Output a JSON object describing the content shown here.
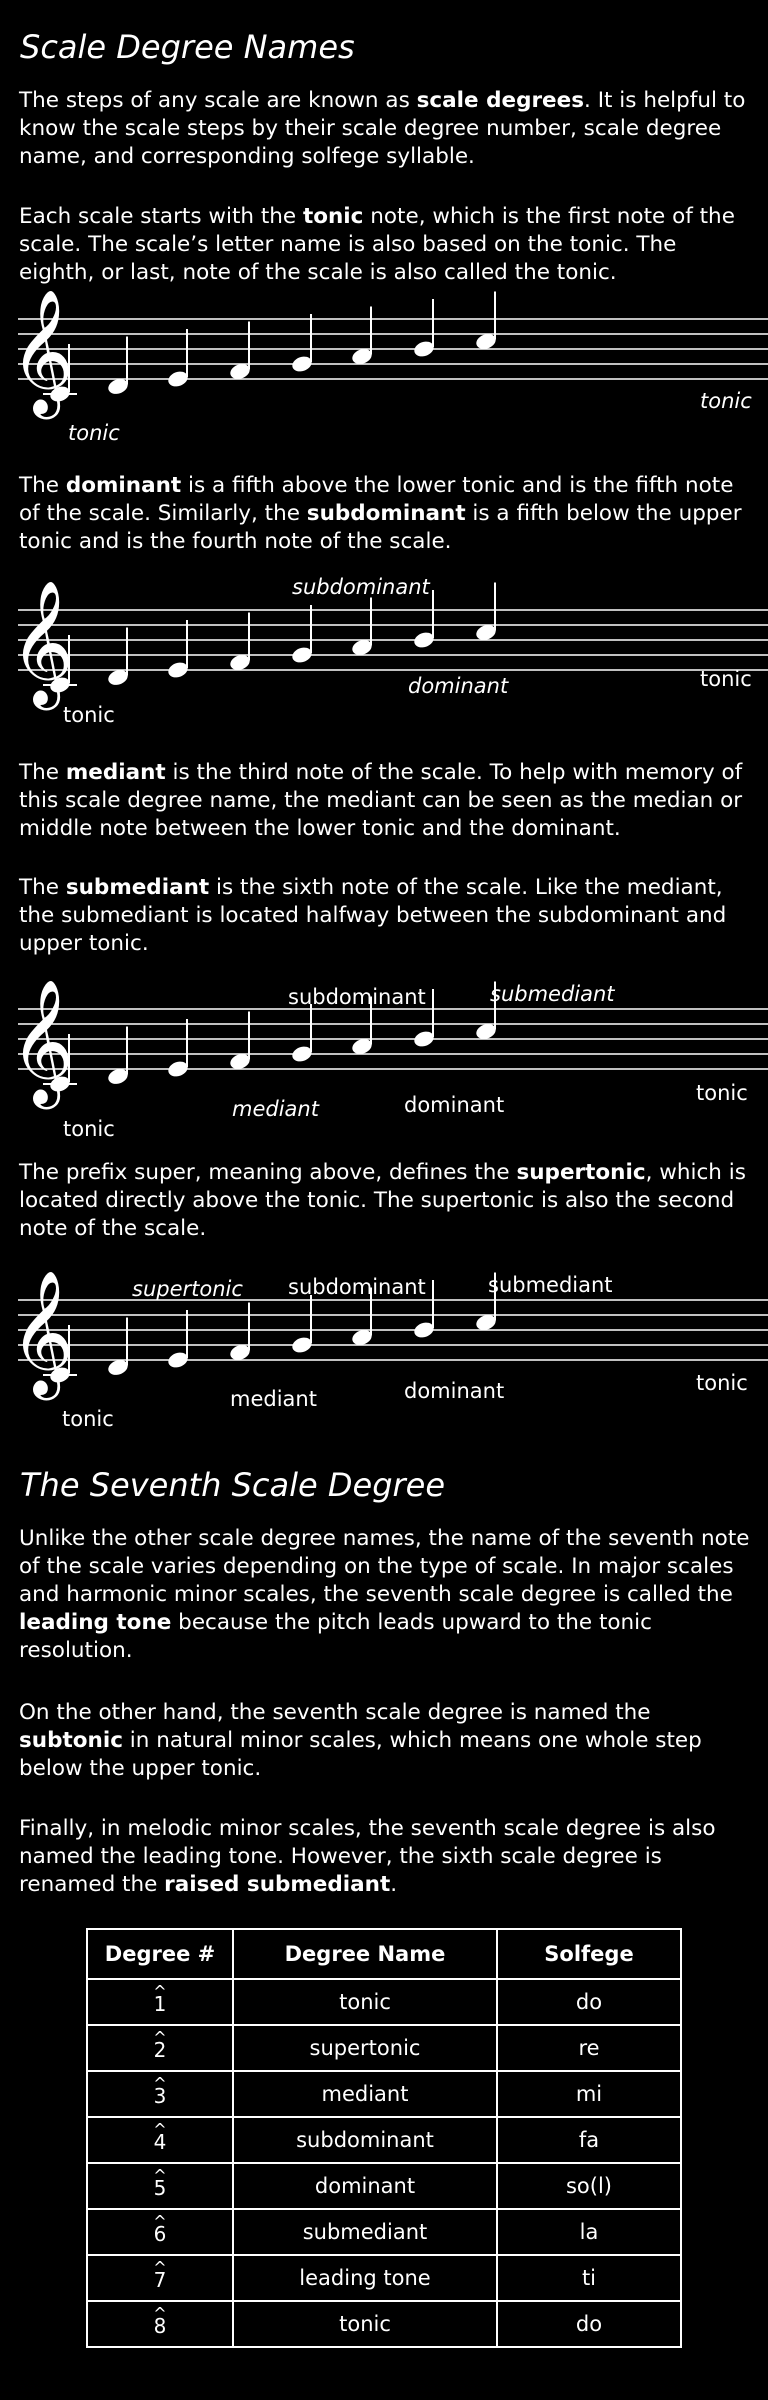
{
  "heading1": "Scale Degree Names",
  "para1": {
    "t1": "The steps of any scale are known as ",
    "b1": "scale degrees",
    "t2": ". It is helpful to know the scale steps by their scale degree number, scale degree name, and corresponding solfege syllable."
  },
  "para2": {
    "t1": "Each scale starts with the ",
    "b1": "tonic",
    "t2": " note, which is the first note of the scale. The scale’s letter name is also based on the tonic. The eighth, or last, note of the scale is also called the tonic."
  },
  "staff1": {
    "tonic_low": "tonic",
    "tonic_high": "tonic"
  },
  "para3": {
    "t1": "The ",
    "b1": "dominant",
    "t2": " is a fifth above the lower tonic and is the fifth note of the scale. Similarly, the ",
    "b2": "subdominant",
    "t3": " is a fifth below the upper tonic and is the fourth note of the scale."
  },
  "staff2": {
    "subdominant": "subdominant",
    "dominant": "dominant",
    "tonic_low": "tonic",
    "tonic_high": "tonic"
  },
  "para4": {
    "t1": "The ",
    "b1": "mediant",
    "t2": " is the third note of the scale. To help with memory of this scale degree name, the mediant can be seen as the median or middle note between the lower tonic and the dominant."
  },
  "para5": {
    "t1": "The ",
    "b1": "submediant",
    "t2": " is the sixth note of the scale. Like the mediant, the submediant is located halfway between the subdominant and upper tonic."
  },
  "staff3": {
    "subdominant": "subdominant",
    "submediant": "submediant",
    "mediant": "mediant",
    "dominant": "dominant",
    "tonic_low": "tonic",
    "tonic_high": "tonic"
  },
  "para6": {
    "t1": "The prefix super, meaning above, defines the ",
    "b1": "supertonic",
    "t2": ", which is located directly above the tonic. The supertonic is also the second note of the scale."
  },
  "staff4": {
    "supertonic": "supertonic",
    "subdominant": "subdominant",
    "submediant": "submediant",
    "mediant": "mediant",
    "dominant": "dominant",
    "tonic_low": "tonic",
    "tonic_high": "tonic"
  },
  "heading2": "The Seventh Scale Degree",
  "para7": {
    "t1": "Unlike the other scale degree names, the name of the seventh note of the scale varies depending on the type of scale. In major scales and harmonic minor scales, the seventh scale degree is called the ",
    "b1": "leading tone",
    "t2": " because the pitch leads upward to the tonic resolution."
  },
  "para8": {
    "t1": "On the other hand, the seventh scale degree is named the ",
    "b1": "subtonic",
    "t2": " in natural minor scales, which means one whole step below the upper tonic."
  },
  "para9": {
    "t1": "Finally, in melodic minor scales, the seventh scale degree is also named the leading tone. However, the sixth scale degree is renamed the ",
    "b1": "raised submediant",
    "t2": "."
  },
  "table": {
    "headers": [
      "Degree #",
      "Degree Name",
      "Solfege"
    ],
    "caret": "^",
    "rows": [
      {
        "num": "1",
        "name": "tonic",
        "solfege": "do"
      },
      {
        "num": "2",
        "name": "supertonic",
        "solfege": "re"
      },
      {
        "num": "3",
        "name": "mediant",
        "solfege": "mi"
      },
      {
        "num": "4",
        "name": "subdominant",
        "solfege": "fa"
      },
      {
        "num": "5",
        "name": "dominant",
        "solfege": "so(l)"
      },
      {
        "num": "6",
        "name": "submediant",
        "solfege": "la"
      },
      {
        "num": "7",
        "name": "leading tone",
        "solfege": "ti"
      },
      {
        "num": "8",
        "name": "tonic",
        "solfege": "do"
      }
    ]
  },
  "clef_glyph": "𝄞"
}
